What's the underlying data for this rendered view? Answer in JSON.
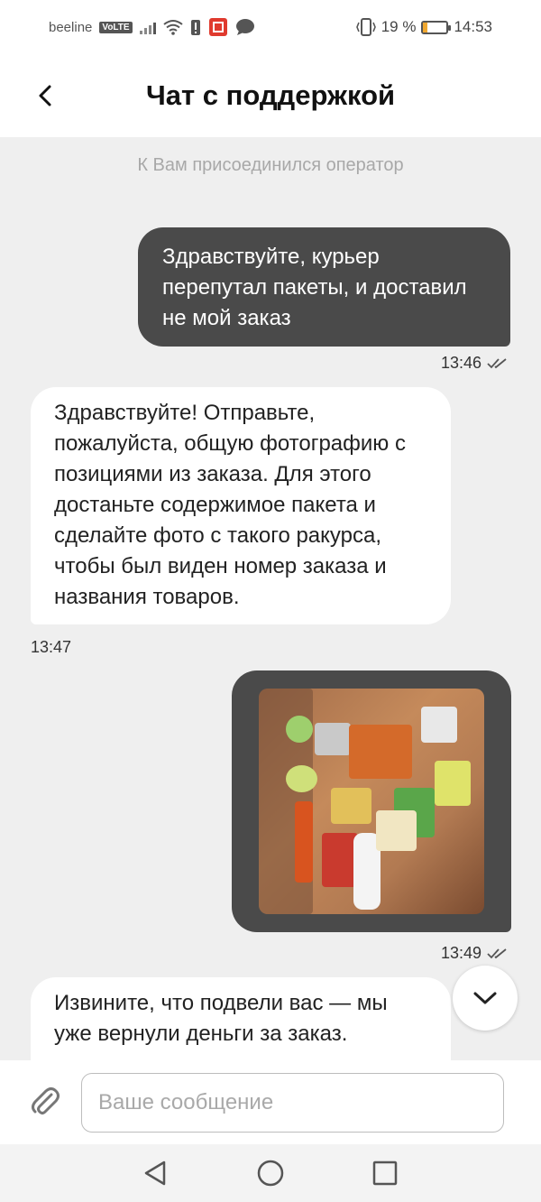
{
  "status_bar": {
    "carrier": "beeline",
    "volte": "VoLTE",
    "battery_percent": "19 %",
    "battery_level": 0.19,
    "time": "14:53"
  },
  "header": {
    "title": "Чат с поддержкой"
  },
  "chat": {
    "system_message": "К Вам присоединился оператор",
    "messages": [
      {
        "direction": "outgoing",
        "text": "Здравствуйте, курьер перепутал пакеты, и доставил не мой заказ",
        "time": "13:46",
        "read": true
      },
      {
        "direction": "incoming",
        "text": "Здравствуйте! Отправьте, пожалуйста, общую фотографию с позициями из заказа. Для этого достаньте содержимое пакета и сделайте фото с такого ракурса, чтобы был виден номер заказа и названия товаров.",
        "time": "13:47"
      },
      {
        "direction": "outgoing",
        "type": "image",
        "time": "13:49",
        "read": true
      },
      {
        "direction": "incoming",
        "text": "Извините, что подвели вас — мы уже вернули деньги за заказ."
      }
    ]
  },
  "input": {
    "placeholder": "Ваше сообщение"
  },
  "icons": {
    "back": "chevron-left-icon",
    "attach": "paperclip-icon",
    "scroll_down": "chevron-down-icon",
    "nav_back": "triangle-back-icon",
    "nav_home": "circle-home-icon",
    "nav_recents": "square-recents-icon"
  },
  "colors": {
    "outgoing_bubble": "#4a4a4a",
    "incoming_bubble": "#ffffff",
    "chat_background": "#efefef",
    "battery_fill": "#f0a830"
  }
}
